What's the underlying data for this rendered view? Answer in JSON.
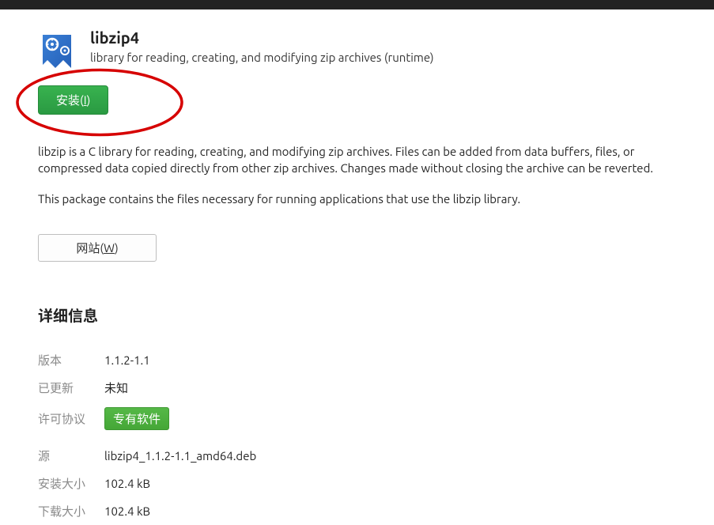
{
  "header": {
    "title": "libzip4",
    "subtitle": "library for reading, creating, and modifying zip archives (runtime)"
  },
  "buttons": {
    "install_label": "安装(I)",
    "website_label": "网站(W)"
  },
  "description": {
    "p1": "libzip is a C library for reading, creating, and modifying zip archives. Files can be added from data buffers, files, or compressed data copied directly from other zip archives. Changes made without closing the archive can be reverted.",
    "p2": "This package contains the files necessary for running applications that use the libzip library."
  },
  "details": {
    "heading": "详细信息",
    "rows": [
      {
        "label": "版本",
        "value": "1.1.2-1.1"
      },
      {
        "label": "已更新",
        "value": "未知"
      },
      {
        "label": "许可协议",
        "value": "专有软件",
        "badge": true
      },
      {
        "label": "源",
        "value": "libzip4_1.1.2-1.1_amd64.deb"
      },
      {
        "label": "安装大小",
        "value": "102.4 kB"
      },
      {
        "label": "下载大小",
        "value": "102.4 kB"
      }
    ]
  }
}
